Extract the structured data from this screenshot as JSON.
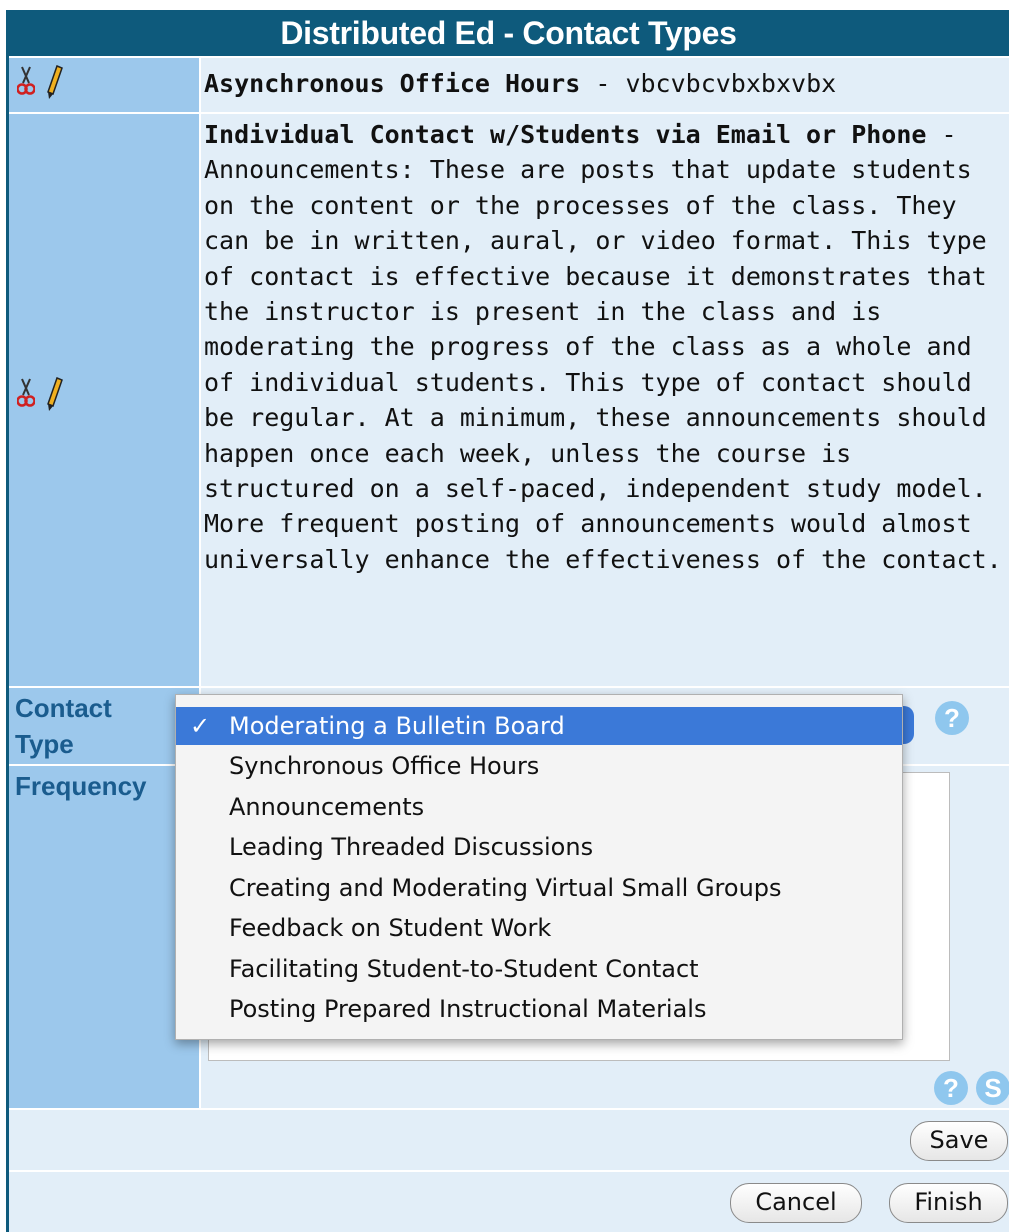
{
  "header": {
    "title": "Distributed Ed - Contact Types"
  },
  "entries": [
    {
      "title": "Asynchronous Office Hours",
      "separator": " - ",
      "description": "vbcvbcvbxbxvbx"
    },
    {
      "title": "Individual Contact w/Students via Email or Phone",
      "separator": " - ",
      "description": "Announcements: These are posts that update students on the content or the processes of the class. They can be in written, aural, or video format. This type of contact is effective because it demonstrates that the instructor is present in the class and is moderating the progress of the class as a whole and of individual students. This type of contact should be regular. At a minimum, these announcements should happen once each week, unless the course is structured on a self-paced, independent study model. More frequent posting of announcements would almost universally enhance the effectiveness of the contact."
    }
  ],
  "form": {
    "contact_type_label_line1": "Contact",
    "contact_type_label_line2": "Type",
    "frequency_label": "Frequency",
    "help_glyph": "?",
    "spell_glyph": "S"
  },
  "dropdown": {
    "check_mark": "✓",
    "options": [
      "Moderating a Bulletin Board",
      "Synchronous Office Hours",
      "Announcements",
      "Leading Threaded Discussions",
      "Creating and Moderating Virtual Small Groups",
      "Feedback on Student Work",
      "Facilitating Student-to-Student Contact",
      "Posting Prepared Instructional Materials"
    ],
    "selected_index": 0
  },
  "buttons": {
    "save": "Save",
    "cancel": "Cancel",
    "finish": "Finish"
  },
  "icons": {
    "delete": "scissors-icon",
    "edit": "pencil-icon",
    "help": "help-icon",
    "spellcheck": "spellcheck-icon"
  },
  "colors": {
    "header_bg": "#0e5a7c",
    "label_cell_bg": "#9cc8ec",
    "content_cell_bg": "#e2eef8",
    "selection_bg": "#3b79d8",
    "label_text": "#1a5c8e"
  }
}
